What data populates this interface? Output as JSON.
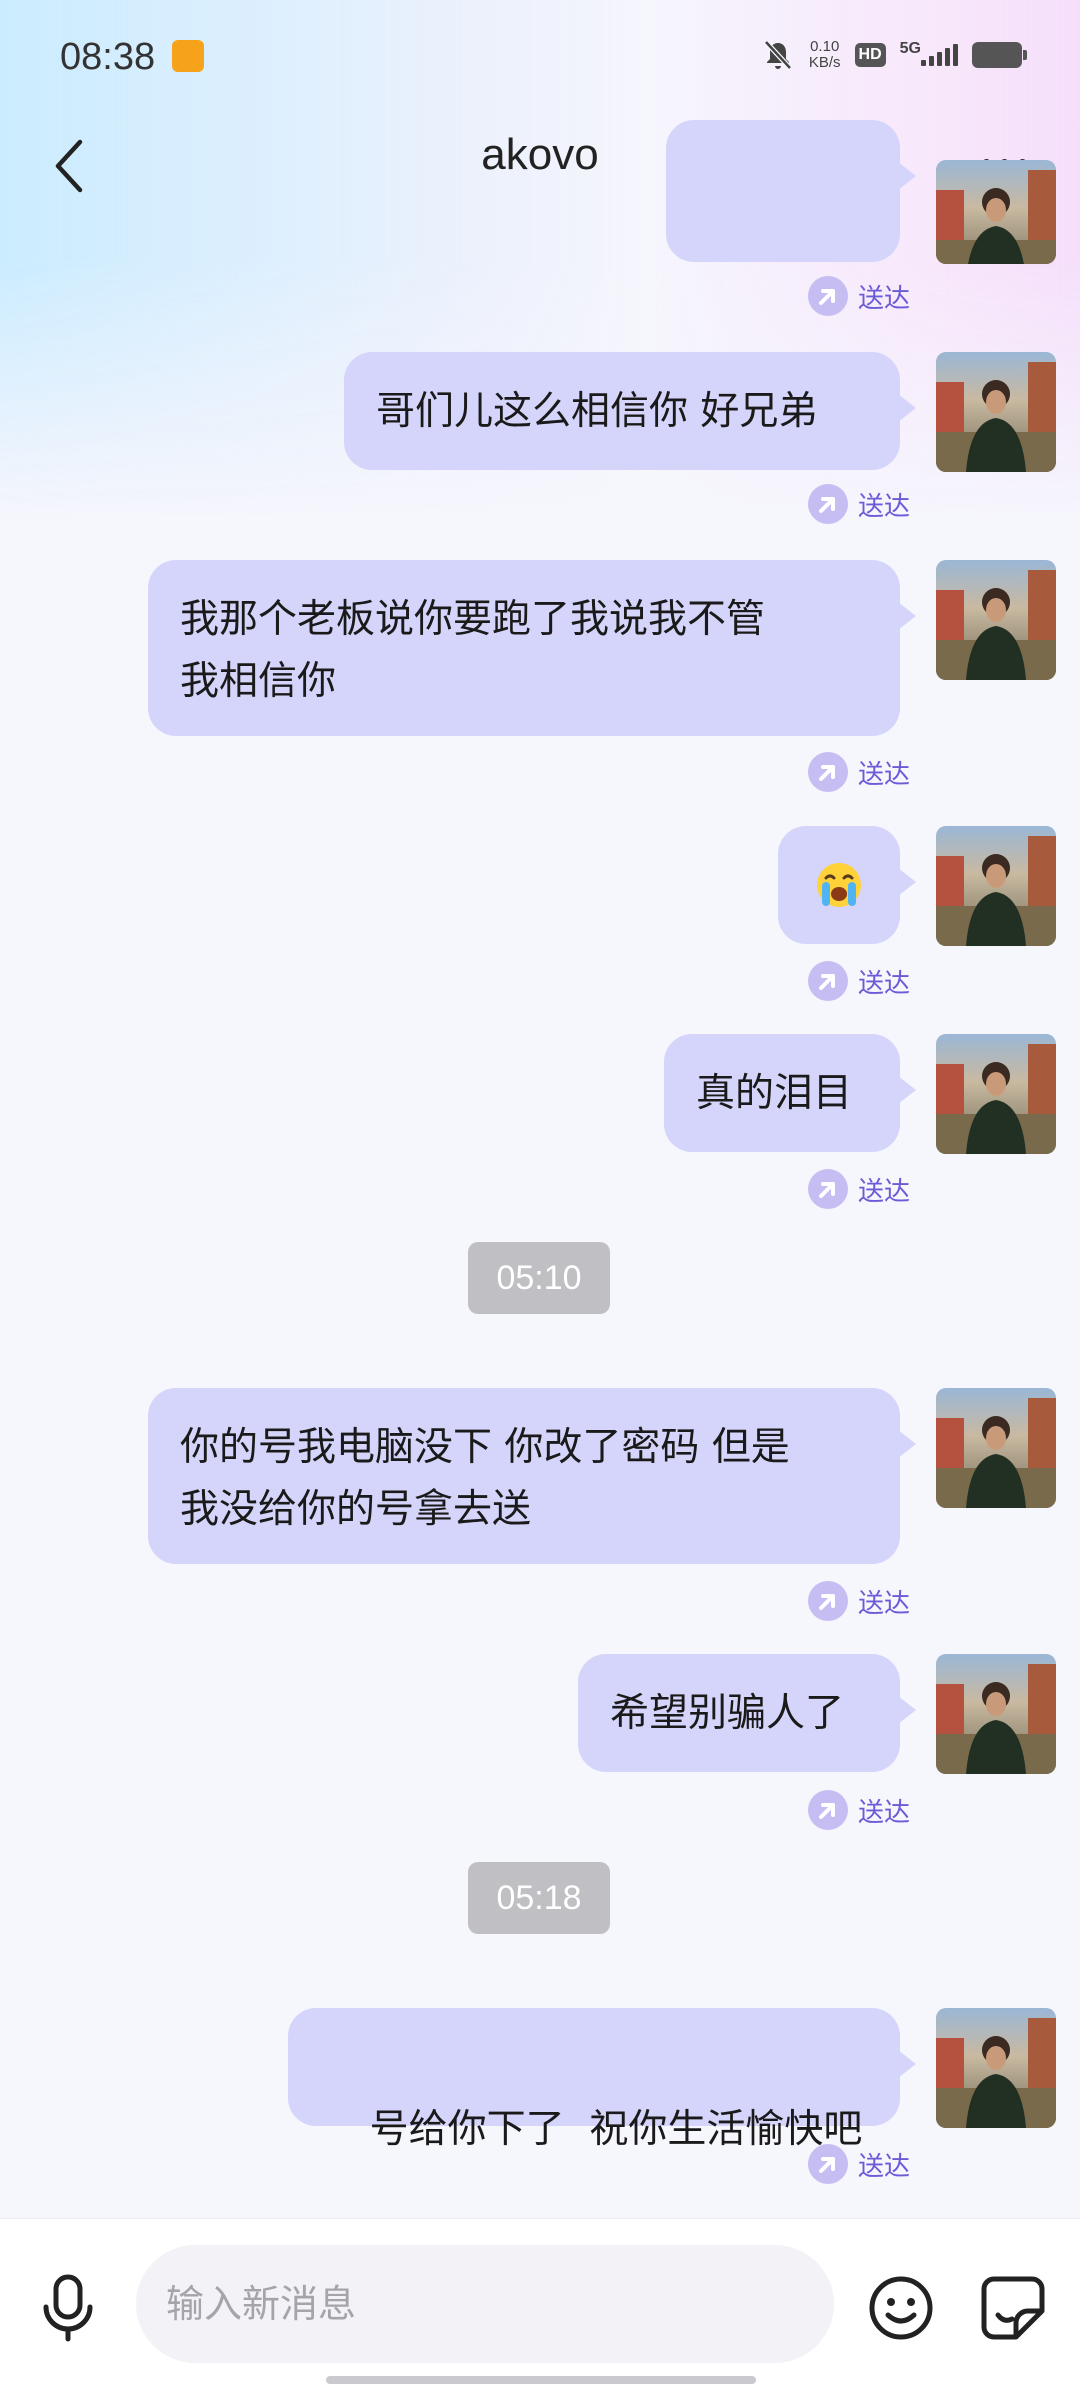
{
  "status_bar": {
    "time": "08:38",
    "net_speed_value": "0.10",
    "net_speed_unit": "KB/s",
    "hd_label": "HD",
    "network": "5G"
  },
  "header": {
    "title": "akovo",
    "back_icon": "chevron-left-icon",
    "more_icon": "more-dots-icon"
  },
  "delivered_label": "送达",
  "messages": [
    {
      "text": "哥们儿这么相信你 好兄弟",
      "status": "送达"
    },
    {
      "text": "我那个老板说你要跑了我说我不管我相信你",
      "line1": "我那个老板说你要跑了我说我不管",
      "line2": "我相信你",
      "status": "送达"
    },
    {
      "emoji": "crying-face-emoji",
      "status": "送达"
    },
    {
      "text": "真的泪目",
      "status": "送达"
    },
    {
      "time_divider": "05:10"
    },
    {
      "line1": "你的号我电脑没下 你改了密码 但是",
      "line2": "我没给你的号拿去送",
      "status": "送达"
    },
    {
      "text": "希望别骗人了",
      "status": "送达"
    },
    {
      "time_divider": "05:18"
    },
    {
      "text": "号给你下了  祝你生活愉快吧",
      "status": "送达"
    }
  ],
  "composer": {
    "placeholder": "输入新消息",
    "voice_icon": "microphone-icon",
    "emoji_icon": "smiley-icon",
    "sticker_icon": "sticker-icon"
  },
  "colors": {
    "bubble": "#d5d5fb",
    "delivered_accent": "#6a5bd7",
    "time_chip": "#bfbfc4"
  }
}
